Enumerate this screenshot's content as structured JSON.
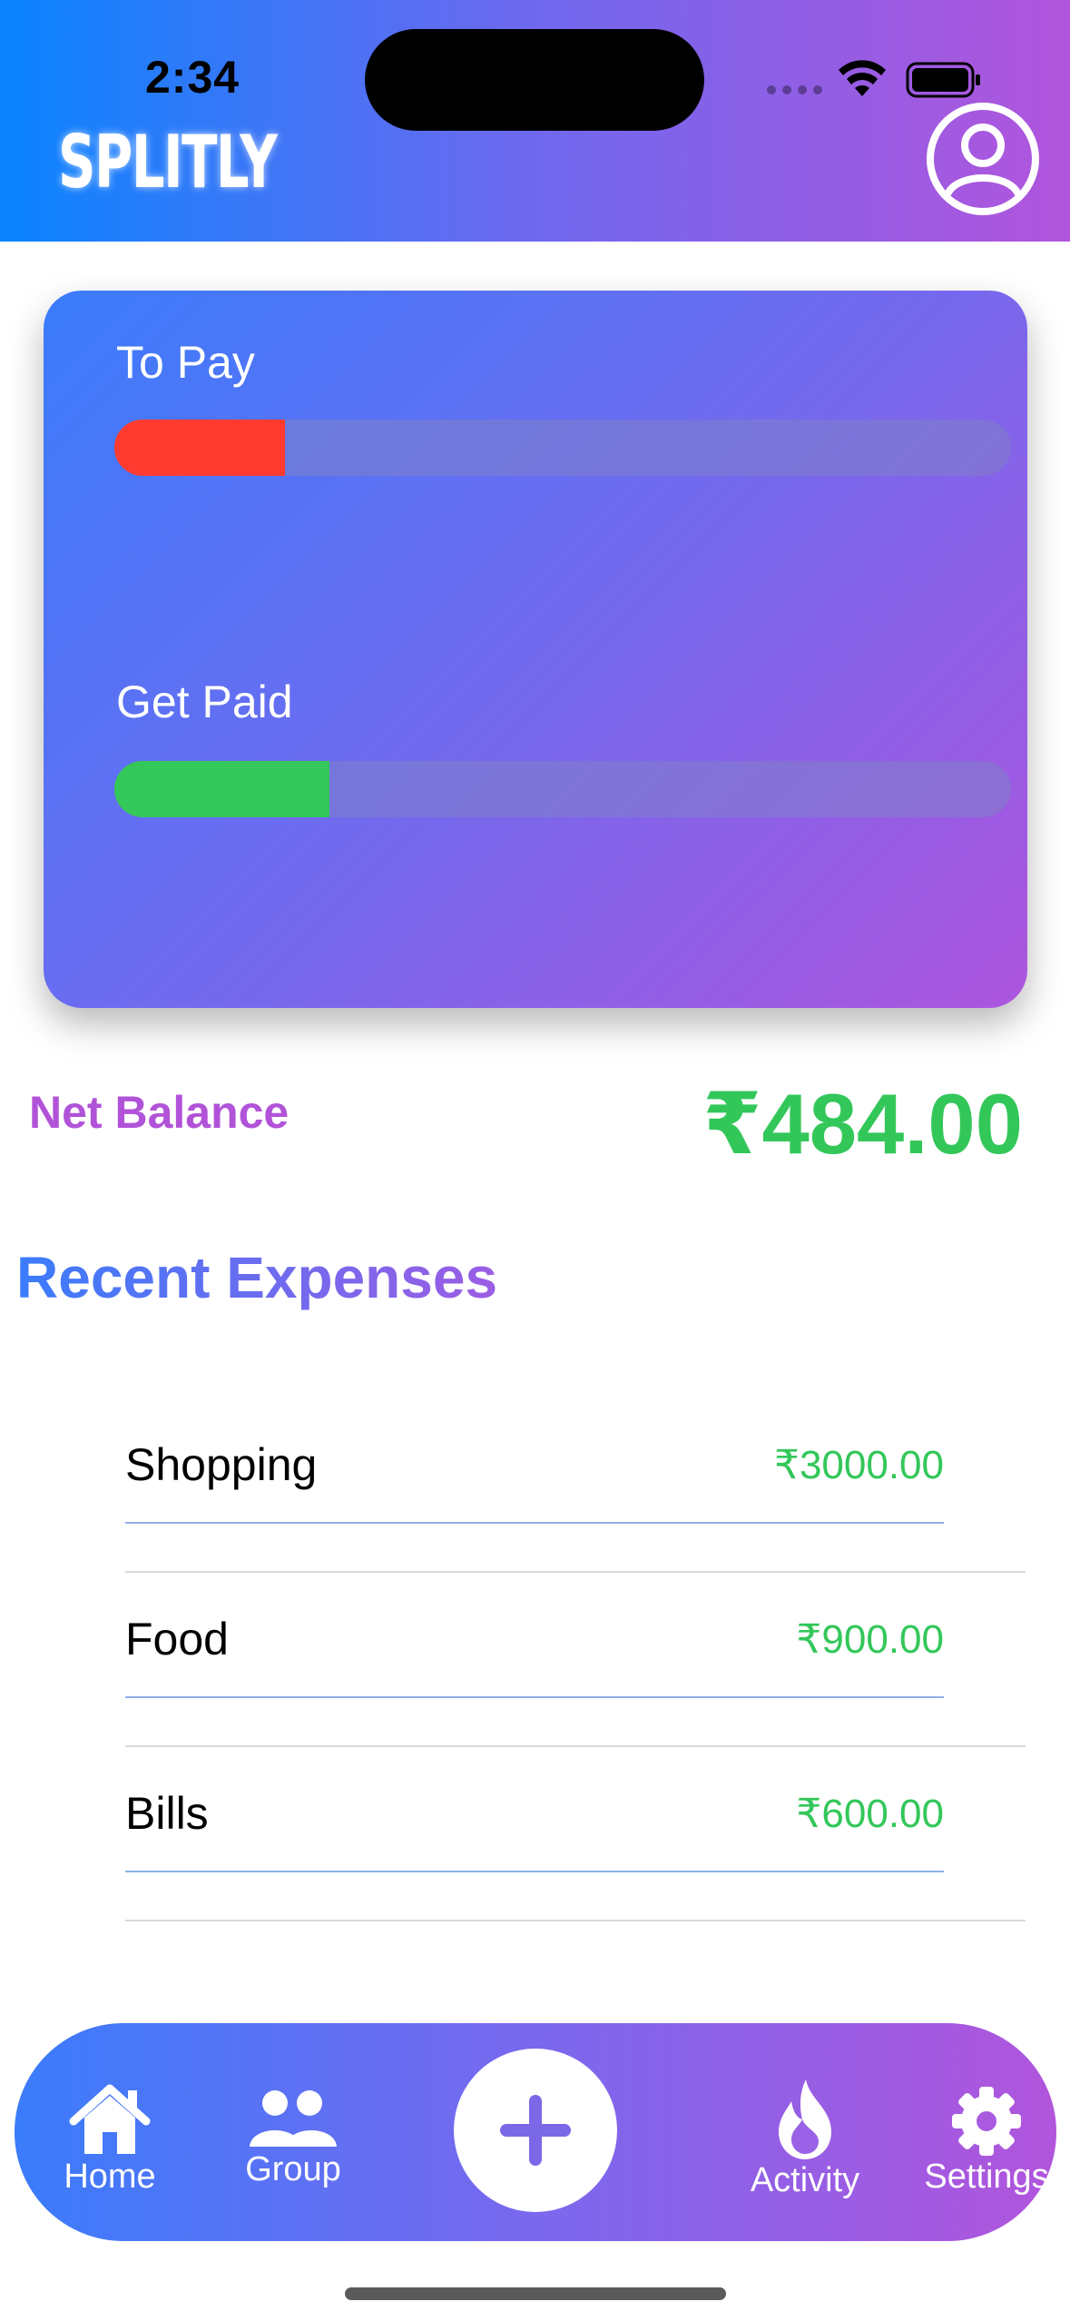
{
  "status_bar": {
    "time": "2:34"
  },
  "header": {
    "app_name": "SPLITLY"
  },
  "summary": {
    "to_pay": {
      "label": "To Pay",
      "progress": 0.19,
      "color": "#ff3b30"
    },
    "get_paid": {
      "label": "Get Paid",
      "progress": 0.24,
      "color": "#34c759"
    }
  },
  "net_balance": {
    "label": "Net Balance",
    "value": "₹484.00"
  },
  "recent_expenses": {
    "title": "Recent Expenses",
    "items": [
      {
        "name": "Shopping",
        "amount": "₹3000.00"
      },
      {
        "name": "Food",
        "amount": "₹900.00"
      },
      {
        "name": "Bills",
        "amount": "₹600.00"
      }
    ]
  },
  "tab_bar": {
    "home": "Home",
    "group": "Group",
    "activity": "Activity",
    "settings": "Settings"
  }
}
